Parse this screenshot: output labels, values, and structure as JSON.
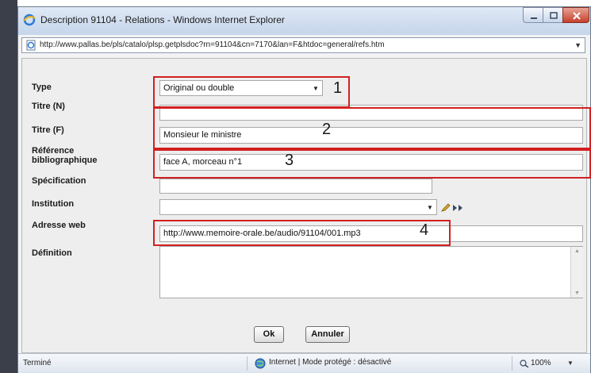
{
  "window": {
    "title": "Description 91104 - Relations - Windows Internet Explorer"
  },
  "address": {
    "url": "http://www.pallas.be/pls/catalo/plsp.getplsdoc?rn=91104&cn=7170&lan=F&htdoc=general/refs.htm"
  },
  "form": {
    "type_label": "Type",
    "type_value": "Original ou double",
    "titre_n_label": "Titre (N)",
    "titre_n_value": "",
    "titre_f_label": "Titre (F)",
    "titre_f_value": "Monsieur le ministre",
    "reference_label_line1": "Référence",
    "reference_label_line2": "bibliographique",
    "reference_value": "face A, morceau n°1",
    "specification_label": "Spécification",
    "specification_value": "",
    "institution_label": "Institution",
    "institution_value": "",
    "adresse_label": "Adresse web",
    "adresse_value": "http://www.memoire-orale.be/audio/91104/001.mp3",
    "definition_label": "Définition",
    "definition_value": ""
  },
  "annotations": [
    "1",
    "2",
    "3",
    "4"
  ],
  "buttons": {
    "ok": "Ok",
    "annuler": "Annuler"
  },
  "status": {
    "left": "Terminé",
    "zone": "Internet | Mode protégé : désactivé",
    "zoom": "100%"
  },
  "colors": {
    "annotation_red": "#d22020",
    "titlebar": "#c6d5ea"
  },
  "icons": [
    "ie-icon",
    "page-icon",
    "dropdown-arrow-icon",
    "edit-pencil-icon",
    "navigate-arrows-icon",
    "globe-icon",
    "zoom-icon"
  ]
}
